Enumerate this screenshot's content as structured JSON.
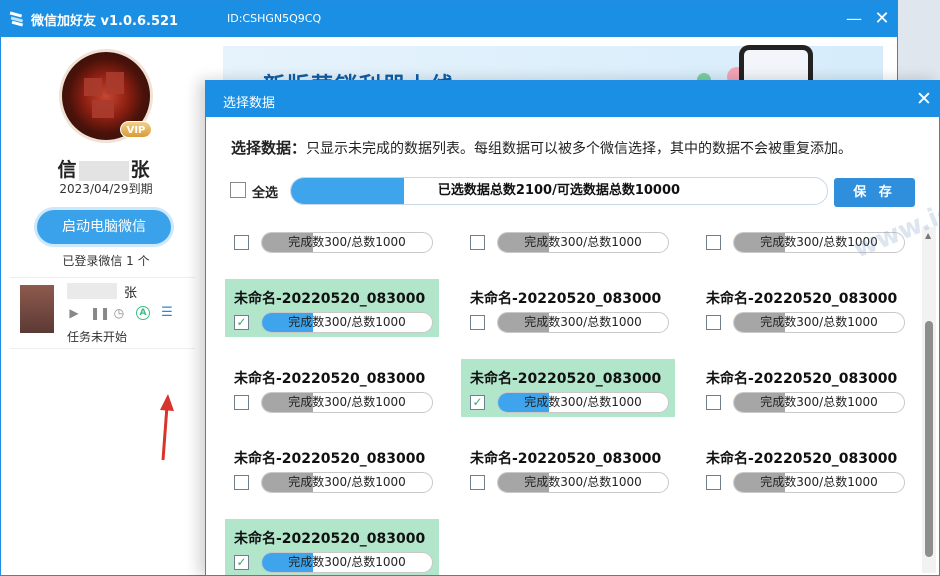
{
  "app": {
    "title": "微信加好友 v1.0.6.521",
    "device_id": "ID:CSHGN5Q9CQ",
    "minimize_glyph": "—",
    "close_glyph": "✕"
  },
  "sidebar": {
    "vip_label": "VIP",
    "user_name_start": "信",
    "user_name_end": "张",
    "expire_date": "2023/04/29到期",
    "start_button": "启动电脑微信",
    "logged_count": "已登录微信 1 个",
    "account": {
      "name_suffix": "张",
      "status": "任务未开始"
    }
  },
  "banner": {
    "text": "新版营销利器上线"
  },
  "dialog": {
    "title": "选择数据",
    "instruction_bold": "选择数据：",
    "instruction_text": "只显示未完成的数据列表。每组数据可以被多个微信选择，其中的数据不会被重复添加。",
    "select_all": "全选",
    "total_progress_text": "已选数据总数2100/可选数据总数10000",
    "total_progress_ratio": 0.21,
    "save_button": "保 存",
    "items": [
      {
        "name": "",
        "selected": false,
        "bar_text": "完成数300/总数1000",
        "ratio": 0.3
      },
      {
        "name": "",
        "selected": false,
        "bar_text": "完成数300/总数1000",
        "ratio": 0.3
      },
      {
        "name": "",
        "selected": false,
        "bar_text": "完成数300/总数1000",
        "ratio": 0.3
      },
      {
        "name": "未命名-20220520_083000",
        "selected": true,
        "bar_text": "完成数300/总数1000",
        "ratio": 0.3
      },
      {
        "name": "未命名-20220520_083000",
        "selected": false,
        "bar_text": "完成数300/总数1000",
        "ratio": 0.3
      },
      {
        "name": "未命名-20220520_083000",
        "selected": false,
        "bar_text": "完成数300/总数1000",
        "ratio": 0.3
      },
      {
        "name": "未命名-20220520_083000",
        "selected": false,
        "bar_text": "完成数300/总数1000",
        "ratio": 0.3
      },
      {
        "name": "未命名-20220520_083000",
        "selected": true,
        "bar_text": "完成数300/总数1000",
        "ratio": 0.3
      },
      {
        "name": "未命名-20220520_083000",
        "selected": false,
        "bar_text": "完成数300/总数1000",
        "ratio": 0.3
      },
      {
        "name": "未命名-20220520_083000",
        "selected": false,
        "bar_text": "完成数300/总数1000",
        "ratio": 0.3
      },
      {
        "name": "未命名-20220520_083000",
        "selected": false,
        "bar_text": "完成数300/总数1000",
        "ratio": 0.3
      },
      {
        "name": "未命名-20220520_083000",
        "selected": false,
        "bar_text": "完成数300/总数1000",
        "ratio": 0.3
      },
      {
        "name": "未命名-20220520_083000",
        "selected": true,
        "bar_text": "完成数300/总数1000",
        "ratio": 0.3
      }
    ]
  },
  "watermark": "www.idm.org.cn",
  "colors": {
    "titlebar": "#1a8fe3",
    "selected_bg": "#b2e6cb",
    "progress_blue": "#3ea4eb",
    "progress_gray": "#a6a6a6"
  }
}
